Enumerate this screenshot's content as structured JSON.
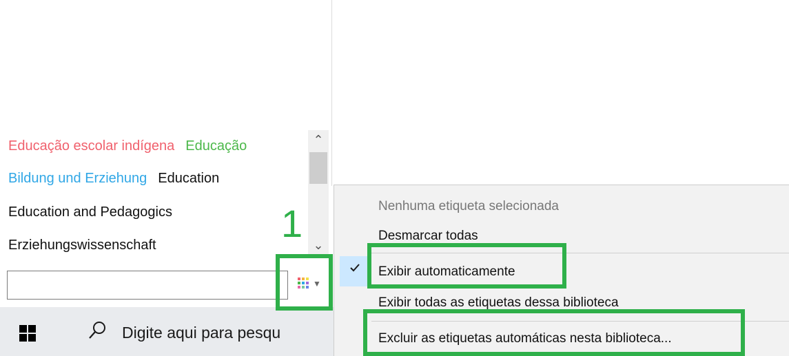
{
  "tags": {
    "rows": [
      [
        {
          "text": "Educação escolar indígena",
          "color": "#f0616d"
        },
        {
          "text": "Educação",
          "color": "#4cb84a"
        }
      ],
      [
        {
          "text": "Bildung und Erziehung",
          "color": "#30a7e6"
        },
        {
          "text": "Education",
          "color": "#111111"
        }
      ],
      [
        {
          "text": "Education and Pedagogics",
          "color": "#111111"
        }
      ],
      [
        {
          "text": "Erziehungswissenschaft",
          "color": "#111111"
        }
      ]
    ]
  },
  "filter": {
    "value": "",
    "placeholder": ""
  },
  "taskbar": {
    "search_placeholder": "Digite aqui para pesqu"
  },
  "menu": {
    "no_tags_selected": "Nenhuma etiqueta selecionada",
    "deselect_all": "Desmarcar todas",
    "show_automatic": "Exibir automaticamente",
    "show_automatic_checked": true,
    "show_all_in_library": "Exibir todas as etiquetas dessa biblioteca",
    "delete_automatic": "Excluir as etiquetas automáticas nesta biblioteca..."
  },
  "annotation": {
    "step_number": "1",
    "color": "#2fb04a"
  }
}
